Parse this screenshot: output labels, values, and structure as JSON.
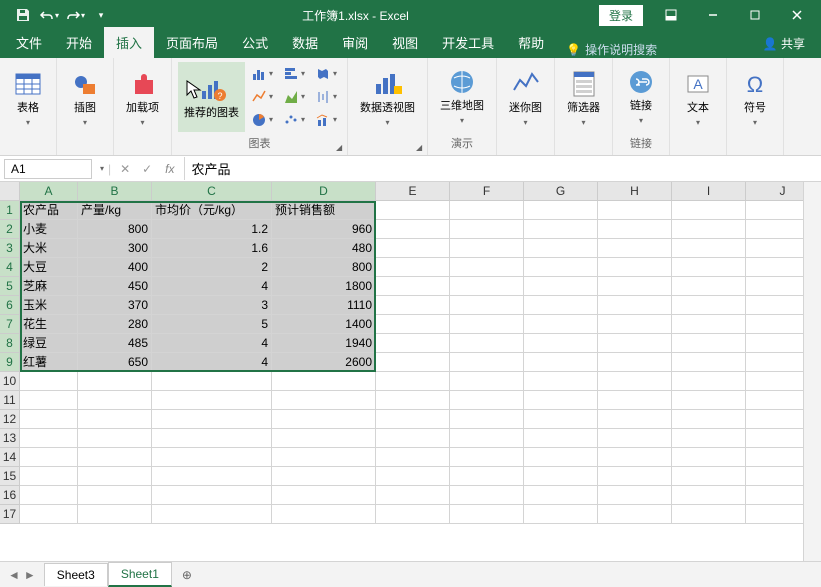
{
  "title": "工作簿1.xlsx  -  Excel",
  "login": "登录",
  "tabs": {
    "file": "文件",
    "home": "开始",
    "insert": "插入",
    "pagelayout": "页面布局",
    "formulas": "公式",
    "data": "数据",
    "review": "审阅",
    "view": "视图",
    "dev": "开发工具",
    "help": "帮助"
  },
  "tell_me": "操作说明搜索",
  "share": "共享",
  "ribbon": {
    "tables": "表格",
    "illustrations": "插图",
    "addins": "加载项",
    "rec_charts": "推荐的图表",
    "charts_label": "图表",
    "pivotchart": "数据透视图",
    "map3d": "三维地图",
    "tours": "演示",
    "sparklines": "迷你图",
    "filters": "筛选器",
    "link": "链接",
    "link_label": "链接",
    "text": "文本",
    "symbols": "符号"
  },
  "namebox": "A1",
  "formula": "农产品",
  "cols": [
    "A",
    "B",
    "C",
    "D",
    "E",
    "F",
    "G",
    "H",
    "I",
    "J"
  ],
  "rows": [
    1,
    2,
    3,
    4,
    5,
    6,
    7,
    8,
    9,
    10,
    11,
    12,
    13,
    14,
    15,
    16,
    17
  ],
  "headers": [
    "农产品",
    "产量/kg",
    "市均价（元/kg）",
    "预计销售额"
  ],
  "data": [
    [
      "小麦",
      "800",
      "1.2",
      "960"
    ],
    [
      "大米",
      "300",
      "1.6",
      "480"
    ],
    [
      "大豆",
      "400",
      "2",
      "800"
    ],
    [
      "芝麻",
      "450",
      "4",
      "1800"
    ],
    [
      "玉米",
      "370",
      "3",
      "1110"
    ],
    [
      "花生",
      "280",
      "5",
      "1400"
    ],
    [
      "绿豆",
      "485",
      "4",
      "1940"
    ],
    [
      "红薯",
      "650",
      "4",
      "2600"
    ]
  ],
  "sheets": [
    "Sheet3",
    "Sheet1"
  ],
  "add_sheet": "⊕",
  "chart_data": {
    "type": "table",
    "title": "农产品",
    "columns": [
      "农产品",
      "产量/kg",
      "市均价（元/kg）",
      "预计销售额"
    ],
    "rows": [
      {
        "农产品": "小麦",
        "产量/kg": 800,
        "市均价（元/kg）": 1.2,
        "预计销售额": 960
      },
      {
        "农产品": "大米",
        "产量/kg": 300,
        "市均价（元/kg）": 1.6,
        "预计销售额": 480
      },
      {
        "农产品": "大豆",
        "产量/kg": 400,
        "市均价（元/kg）": 2,
        "预计销售额": 800
      },
      {
        "农产品": "芝麻",
        "产量/kg": 450,
        "市均价（元/kg）": 4,
        "预计销售额": 1800
      },
      {
        "农产品": "玉米",
        "产量/kg": 370,
        "市均价（元/kg）": 3,
        "预计销售额": 1110
      },
      {
        "农产品": "花生",
        "产量/kg": 280,
        "市均价（元/kg）": 5,
        "预计销售额": 1400
      },
      {
        "农产品": "绿豆",
        "产量/kg": 485,
        "市均价（元/kg）": 4,
        "预计销售额": 1940
      },
      {
        "农产品": "红薯",
        "产量/kg": 650,
        "市均价（元/kg）": 4,
        "预计销售额": 2600
      }
    ]
  }
}
